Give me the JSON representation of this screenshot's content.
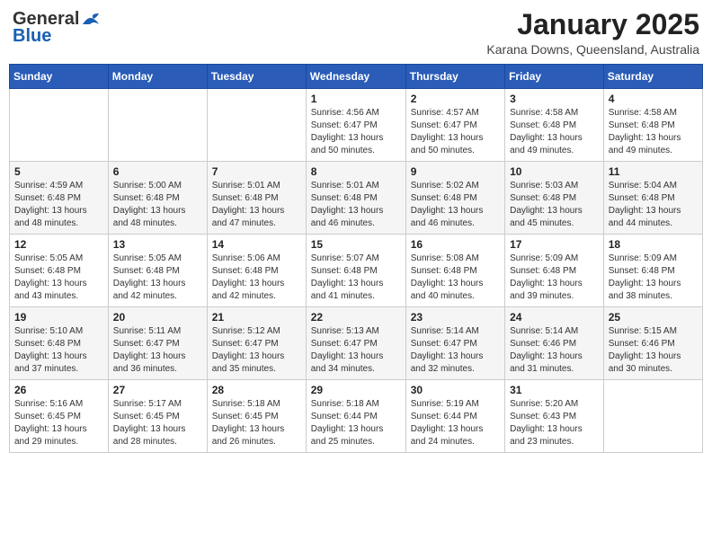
{
  "logo": {
    "general": "General",
    "blue": "Blue"
  },
  "header": {
    "month_title": "January 2025",
    "location": "Karana Downs, Queensland, Australia"
  },
  "weekdays": [
    "Sunday",
    "Monday",
    "Tuesday",
    "Wednesday",
    "Thursday",
    "Friday",
    "Saturday"
  ],
  "weeks": [
    [
      {
        "day": "",
        "info": ""
      },
      {
        "day": "",
        "info": ""
      },
      {
        "day": "",
        "info": ""
      },
      {
        "day": "1",
        "info": "Sunrise: 4:56 AM\nSunset: 6:47 PM\nDaylight: 13 hours\nand 50 minutes."
      },
      {
        "day": "2",
        "info": "Sunrise: 4:57 AM\nSunset: 6:47 PM\nDaylight: 13 hours\nand 50 minutes."
      },
      {
        "day": "3",
        "info": "Sunrise: 4:58 AM\nSunset: 6:48 PM\nDaylight: 13 hours\nand 49 minutes."
      },
      {
        "day": "4",
        "info": "Sunrise: 4:58 AM\nSunset: 6:48 PM\nDaylight: 13 hours\nand 49 minutes."
      }
    ],
    [
      {
        "day": "5",
        "info": "Sunrise: 4:59 AM\nSunset: 6:48 PM\nDaylight: 13 hours\nand 48 minutes."
      },
      {
        "day": "6",
        "info": "Sunrise: 5:00 AM\nSunset: 6:48 PM\nDaylight: 13 hours\nand 48 minutes."
      },
      {
        "day": "7",
        "info": "Sunrise: 5:01 AM\nSunset: 6:48 PM\nDaylight: 13 hours\nand 47 minutes."
      },
      {
        "day": "8",
        "info": "Sunrise: 5:01 AM\nSunset: 6:48 PM\nDaylight: 13 hours\nand 46 minutes."
      },
      {
        "day": "9",
        "info": "Sunrise: 5:02 AM\nSunset: 6:48 PM\nDaylight: 13 hours\nand 46 minutes."
      },
      {
        "day": "10",
        "info": "Sunrise: 5:03 AM\nSunset: 6:48 PM\nDaylight: 13 hours\nand 45 minutes."
      },
      {
        "day": "11",
        "info": "Sunrise: 5:04 AM\nSunset: 6:48 PM\nDaylight: 13 hours\nand 44 minutes."
      }
    ],
    [
      {
        "day": "12",
        "info": "Sunrise: 5:05 AM\nSunset: 6:48 PM\nDaylight: 13 hours\nand 43 minutes."
      },
      {
        "day": "13",
        "info": "Sunrise: 5:05 AM\nSunset: 6:48 PM\nDaylight: 13 hours\nand 42 minutes."
      },
      {
        "day": "14",
        "info": "Sunrise: 5:06 AM\nSunset: 6:48 PM\nDaylight: 13 hours\nand 42 minutes."
      },
      {
        "day": "15",
        "info": "Sunrise: 5:07 AM\nSunset: 6:48 PM\nDaylight: 13 hours\nand 41 minutes."
      },
      {
        "day": "16",
        "info": "Sunrise: 5:08 AM\nSunset: 6:48 PM\nDaylight: 13 hours\nand 40 minutes."
      },
      {
        "day": "17",
        "info": "Sunrise: 5:09 AM\nSunset: 6:48 PM\nDaylight: 13 hours\nand 39 minutes."
      },
      {
        "day": "18",
        "info": "Sunrise: 5:09 AM\nSunset: 6:48 PM\nDaylight: 13 hours\nand 38 minutes."
      }
    ],
    [
      {
        "day": "19",
        "info": "Sunrise: 5:10 AM\nSunset: 6:48 PM\nDaylight: 13 hours\nand 37 minutes."
      },
      {
        "day": "20",
        "info": "Sunrise: 5:11 AM\nSunset: 6:47 PM\nDaylight: 13 hours\nand 36 minutes."
      },
      {
        "day": "21",
        "info": "Sunrise: 5:12 AM\nSunset: 6:47 PM\nDaylight: 13 hours\nand 35 minutes."
      },
      {
        "day": "22",
        "info": "Sunrise: 5:13 AM\nSunset: 6:47 PM\nDaylight: 13 hours\nand 34 minutes."
      },
      {
        "day": "23",
        "info": "Sunrise: 5:14 AM\nSunset: 6:47 PM\nDaylight: 13 hours\nand 32 minutes."
      },
      {
        "day": "24",
        "info": "Sunrise: 5:14 AM\nSunset: 6:46 PM\nDaylight: 13 hours\nand 31 minutes."
      },
      {
        "day": "25",
        "info": "Sunrise: 5:15 AM\nSunset: 6:46 PM\nDaylight: 13 hours\nand 30 minutes."
      }
    ],
    [
      {
        "day": "26",
        "info": "Sunrise: 5:16 AM\nSunset: 6:45 PM\nDaylight: 13 hours\nand 29 minutes."
      },
      {
        "day": "27",
        "info": "Sunrise: 5:17 AM\nSunset: 6:45 PM\nDaylight: 13 hours\nand 28 minutes."
      },
      {
        "day": "28",
        "info": "Sunrise: 5:18 AM\nSunset: 6:45 PM\nDaylight: 13 hours\nand 26 minutes."
      },
      {
        "day": "29",
        "info": "Sunrise: 5:18 AM\nSunset: 6:44 PM\nDaylight: 13 hours\nand 25 minutes."
      },
      {
        "day": "30",
        "info": "Sunrise: 5:19 AM\nSunset: 6:44 PM\nDaylight: 13 hours\nand 24 minutes."
      },
      {
        "day": "31",
        "info": "Sunrise: 5:20 AM\nSunset: 6:43 PM\nDaylight: 13 hours\nand 23 minutes."
      },
      {
        "day": "",
        "info": ""
      }
    ]
  ]
}
